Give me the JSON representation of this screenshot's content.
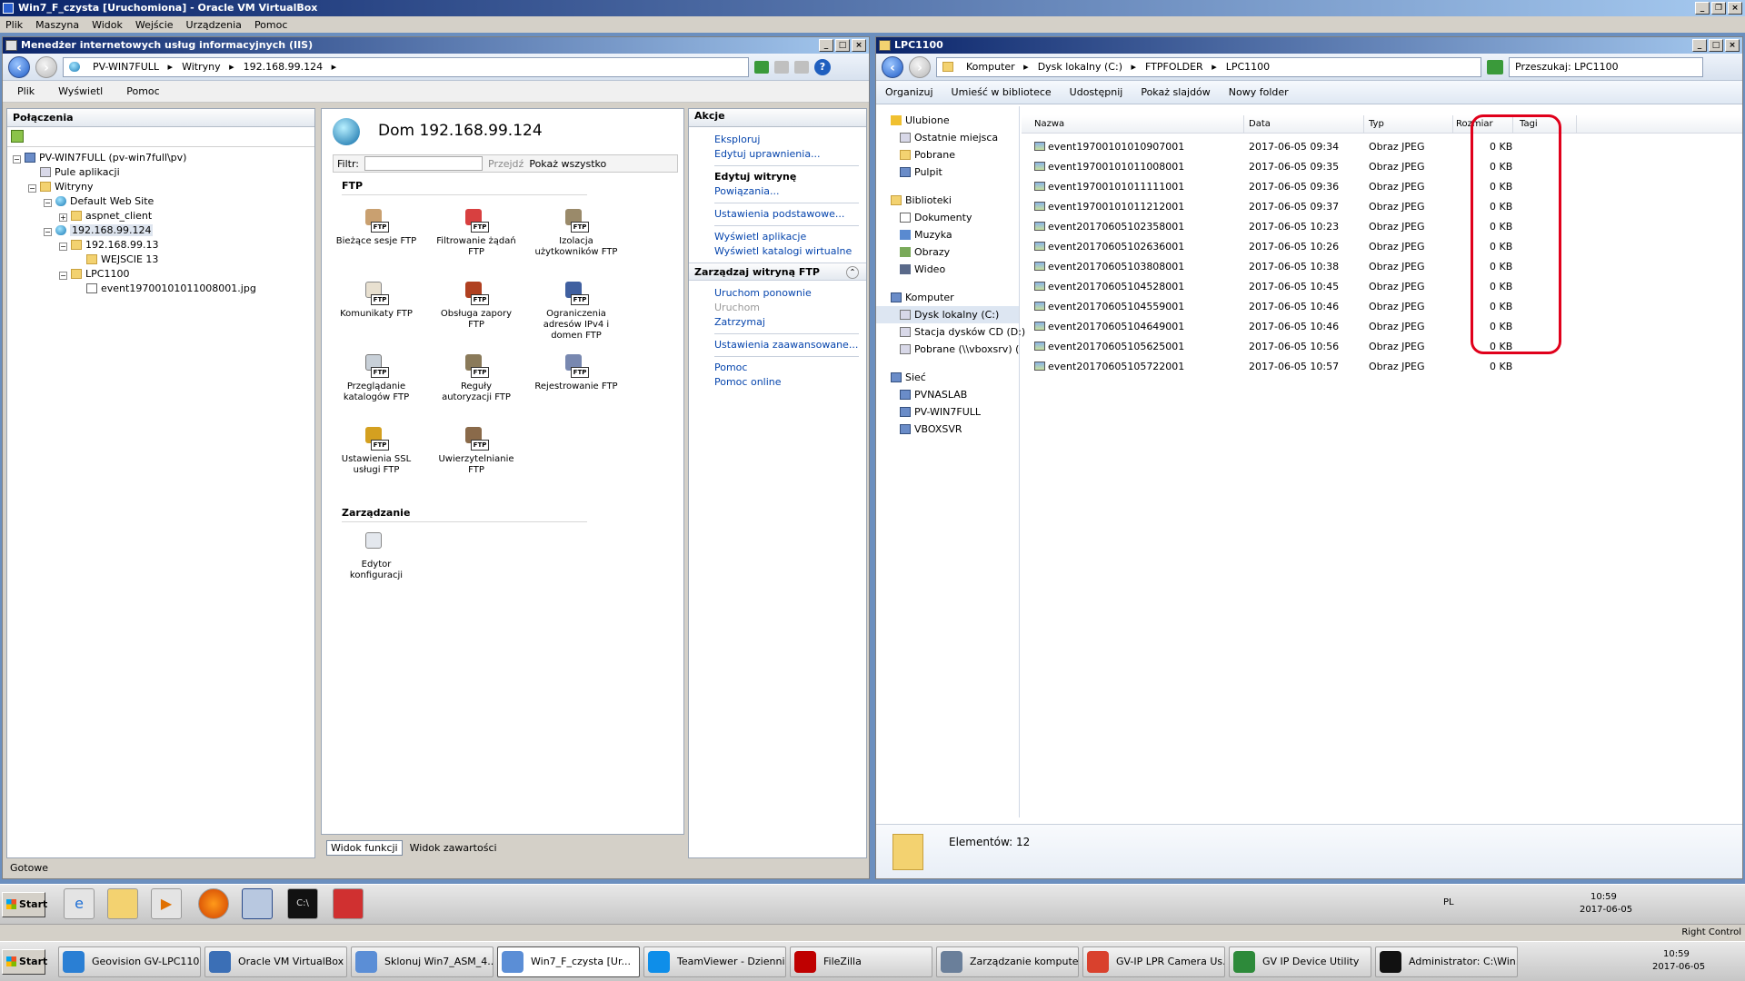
{
  "vbox": {
    "title": "Win7_F_czysta [Uruchomiona] - Oracle VM VirtualBox",
    "menu": [
      "Plik",
      "Maszyna",
      "Widok",
      "Wejście",
      "Urządzenia",
      "Pomoc"
    ]
  },
  "iis": {
    "title": "Menedżer internetowych usług informacyjnych (IIS)",
    "breadcrumb": [
      "PV-WIN7FULL",
      "Witryny",
      "192.168.99.124"
    ],
    "menu": [
      "Plik",
      "Wyświetl",
      "Pomoc"
    ],
    "connections_header": "Połączenia",
    "tree": [
      {
        "label": "PV-WIN7FULL (pv-win7full\\pv)",
        "icon": "server-icon"
      },
      {
        "label": "Pule aplikacji",
        "icon": "app-pool-icon"
      },
      {
        "label": "Witryny",
        "icon": "folder-icon"
      },
      {
        "label": "Default Web Site",
        "icon": "globe-icon"
      },
      {
        "label": "aspnet_client",
        "icon": "folder-icon"
      },
      {
        "label": "192.168.99.124",
        "icon": "globe-icon"
      },
      {
        "label": "192.168.99.13",
        "icon": "folder-icon"
      },
      {
        "label": "WEJSCIE 13",
        "icon": "folder-icon"
      },
      {
        "label": "LPC1100",
        "icon": "folder-icon"
      },
      {
        "label": "event19700101011008001.jpg",
        "icon": "file-icon"
      }
    ],
    "status": "Gotowe",
    "site_title": "Dom 192.168.99.124",
    "filter_label": "Filtr:",
    "go_label": "Przejdź",
    "show_all_label": "Pokaż wszystko",
    "group_ftp": "FTP",
    "group_manage": "Zarządzanie",
    "features": [
      "Bieżące sesje FTP",
      "Filtrowanie żądań FTP",
      "Izolacja użytkowników FTP",
      "Komunikaty FTP",
      "Obsługa zapory FTP",
      "Ograniczenia adresów IPv4 i domen FTP",
      "Przeglądanie katalogów FTP",
      "Reguły autoryzacji FTP",
      "Rejestrowanie FTP",
      "Ustawienia SSL usługi FTP",
      "Uwierzytelnianie FTP"
    ],
    "manage_features": [
      "Edytor konfiguracji"
    ],
    "view_tabs": [
      "Widok funkcji",
      "Widok zawartości"
    ],
    "actions_header": "Akcje",
    "actions": {
      "explore": "Eksploruj",
      "edit_perms": "Edytuj uprawnienia...",
      "edit_site": "Edytuj witrynę",
      "bindings": "Powiązania...",
      "basic_settings": "Ustawienia podstawowe...",
      "view_apps": "Wyświetl aplikacje",
      "view_vdirs": "Wyświetl katalogi wirtualne",
      "manage_ftp": "Zarządzaj witryną FTP",
      "restart": "Uruchom ponownie",
      "start": "Uruchom",
      "stop": "Zatrzymaj",
      "advanced": "Ustawienia zaawansowane...",
      "help": "Pomoc",
      "help_online": "Pomoc online"
    }
  },
  "explorer": {
    "title": "LPC1100",
    "breadcrumb": [
      "Komputer",
      "Dysk lokalny (C:)",
      "FTPFOLDER",
      "LPC1100"
    ],
    "search_placeholder": "Przeszukaj: LPC1100",
    "toolbar": [
      "Organizuj",
      "Umieść w bibliotece",
      "Udostępnij",
      "Pokaż slajdów",
      "Nowy folder"
    ],
    "nav": [
      {
        "label": "Ulubione",
        "icon": "star-icon",
        "level": 0
      },
      {
        "label": "Ostatnie miejsca",
        "icon": "recent-icon",
        "level": 1
      },
      {
        "label": "Pobrane",
        "icon": "folder-icon",
        "level": 1
      },
      {
        "label": "Pulpit",
        "icon": "desktop-icon",
        "level": 1
      },
      {
        "label": "Biblioteki",
        "icon": "library-icon",
        "level": 0
      },
      {
        "label": "Dokumenty",
        "icon": "documents-icon",
        "level": 1
      },
      {
        "label": "Muzyka",
        "icon": "music-icon",
        "level": 1
      },
      {
        "label": "Obrazy",
        "icon": "pictures-icon",
        "level": 1
      },
      {
        "label": "Wideo",
        "icon": "video-icon",
        "level": 1
      },
      {
        "label": "Komputer",
        "icon": "computer-icon",
        "level": 0
      },
      {
        "label": "Dysk lokalny (C:)",
        "icon": "drive-icon",
        "level": 1
      },
      {
        "label": "Stacja dysków CD (D:)",
        "icon": "cd-icon",
        "level": 1
      },
      {
        "label": "Pobrane (\\\\vboxsrv) (",
        "icon": "network-drive-icon",
        "level": 1
      },
      {
        "label": "Sieć",
        "icon": "network-icon",
        "level": 0
      },
      {
        "label": "PVNASLAB",
        "icon": "computer-icon",
        "level": 1
      },
      {
        "label": "PV-WIN7FULL",
        "icon": "computer-icon",
        "level": 1
      },
      {
        "label": "VBOXSVR",
        "icon": "computer-icon",
        "level": 1
      }
    ],
    "columns": [
      "Nazwa",
      "Data",
      "Typ",
      "Rozmiar",
      "Tagi"
    ],
    "files": [
      {
        "name": "event19700101010907001",
        "date": "2017-06-05 09:34",
        "type": "Obraz JPEG",
        "size": "0 KB"
      },
      {
        "name": "event19700101011008001",
        "date": "2017-06-05 09:35",
        "type": "Obraz JPEG",
        "size": "0 KB"
      },
      {
        "name": "event19700101011111001",
        "date": "2017-06-05 09:36",
        "type": "Obraz JPEG",
        "size": "0 KB"
      },
      {
        "name": "event19700101011212001",
        "date": "2017-06-05 09:37",
        "type": "Obraz JPEG",
        "size": "0 KB"
      },
      {
        "name": "event20170605102358001",
        "date": "2017-06-05 10:23",
        "type": "Obraz JPEG",
        "size": "0 KB"
      },
      {
        "name": "event20170605102636001",
        "date": "2017-06-05 10:26",
        "type": "Obraz JPEG",
        "size": "0 KB"
      },
      {
        "name": "event20170605103808001",
        "date": "2017-06-05 10:38",
        "type": "Obraz JPEG",
        "size": "0 KB"
      },
      {
        "name": "event20170605104528001",
        "date": "2017-06-05 10:45",
        "type": "Obraz JPEG",
        "size": "0 KB"
      },
      {
        "name": "event20170605104559001",
        "date": "2017-06-05 10:46",
        "type": "Obraz JPEG",
        "size": "0 KB"
      },
      {
        "name": "event20170605104649001",
        "date": "2017-06-05 10:46",
        "type": "Obraz JPEG",
        "size": "0 KB"
      },
      {
        "name": "event20170605105625001",
        "date": "2017-06-05 10:56",
        "type": "Obraz JPEG",
        "size": "0 KB"
      },
      {
        "name": "event20170605105722001",
        "date": "2017-06-05 10:57",
        "type": "Obraz JPEG",
        "size": "0 KB"
      }
    ],
    "status": "Elementów: 12",
    "highlight_color": "#e0001b"
  },
  "guest_taskbar": {
    "start": "Start",
    "lang": "PL",
    "time": "10:59",
    "date": "2017-06-05",
    "quick": [
      "ie-icon",
      "explorer-icon",
      "media-player-icon",
      "firefox-icon",
      "iis-icon",
      "cmd-icon",
      "toolbox-icon"
    ]
  },
  "host_taskbar": {
    "start": "Start",
    "right_control": "Right Control",
    "time": "10:59",
    "date": "2017-06-05",
    "apps": [
      {
        "label": "Geovision GV-LPC110...",
        "icon": "ie-icon",
        "color": "#2a7fd4"
      },
      {
        "label": "Oracle VM VirtualBox ...",
        "icon": "virtualbox-icon",
        "color": "#3b6fb6"
      },
      {
        "label": "Sklonuj Win7_ASM_4...",
        "icon": "vm-icon",
        "color": "#5b8ed6"
      },
      {
        "label": "Win7_F_czysta [Ur...",
        "icon": "vm-icon",
        "color": "#5b8ed6"
      },
      {
        "label": "TeamViewer - Dzienni...",
        "icon": "teamviewer-icon",
        "color": "#0e8ee9"
      },
      {
        "label": "FileZilla",
        "icon": "filezilla-icon",
        "color": "#bf0000"
      },
      {
        "label": "Zarządzanie kompute...",
        "icon": "computer-management-icon",
        "color": "#6a7f9a"
      },
      {
        "label": "GV-IP LPR Camera Us...",
        "icon": "chrome-icon",
        "color": "#d9412d"
      },
      {
        "label": "GV IP Device Utility",
        "icon": "gv-utility-icon",
        "color": "#2d8a3a"
      },
      {
        "label": "Administrator: C:\\Win...",
        "icon": "cmd-icon",
        "color": "#111111"
      }
    ]
  }
}
